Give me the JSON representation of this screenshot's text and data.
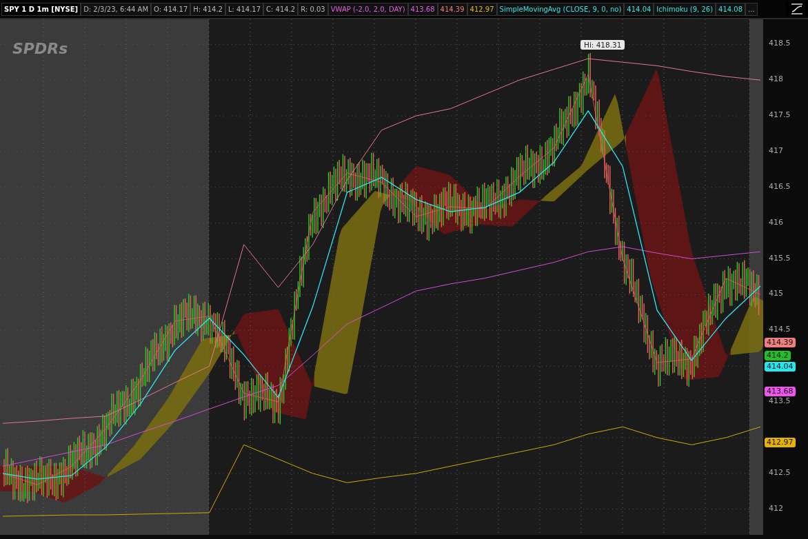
{
  "header": {
    "symbol": "SPY 1 D 1m [NYSE]",
    "items": [
      {
        "text": "D: 2/3/23, 6:44 AM",
        "color": "#b8b8b8"
      },
      {
        "text": "O: 414.17",
        "color": "#b8b8b8"
      },
      {
        "text": "H: 414.2",
        "color": "#b8b8b8"
      },
      {
        "text": "L: 414.17",
        "color": "#b8b8b8"
      },
      {
        "text": "C: 414.2",
        "color": "#b8b8b8"
      },
      {
        "text": "R: 0.03",
        "color": "#b8b8b8"
      },
      {
        "text": "VWAP (-2.0, 2.0, DAY)",
        "color": "#e65ce6"
      },
      {
        "text": "413.68",
        "color": "#e65ce6"
      },
      {
        "text": "414.39",
        "color": "#f07878"
      },
      {
        "text": "412.97",
        "color": "#e6b800"
      },
      {
        "text": "SimpleMovingAvg (CLOSE, 9, 0, no)",
        "color": "#2ee6e6"
      },
      {
        "text": "414.04",
        "color": "#2ee6e6"
      },
      {
        "text": "Ichimoku (9, 26)",
        "color": "#2ee6e6"
      },
      {
        "text": "414.08",
        "color": "#2ee6e6"
      },
      {
        "text": "..."
      }
    ]
  },
  "chart": {
    "logo": "SPDRs",
    "high_label": "Hi: 418.31",
    "price_badges": [
      {
        "text": "414.39",
        "color": "#f08080"
      },
      {
        "text": "414.2",
        "color": "#22c022"
      },
      {
        "text": "414.04",
        "color": "#22e8f0"
      },
      {
        "text": "413.68",
        "color": "#ee55ee"
      },
      {
        "text": "412.97",
        "color": "#e6b400"
      }
    ],
    "chart_data": {
      "type": "line",
      "grid": true,
      "ylim": [
        411.64,
        418.85
      ],
      "yticks": [
        418.5,
        418,
        417.5,
        417,
        416.5,
        416,
        415.5,
        415,
        414.5,
        413.5,
        412.5,
        412
      ],
      "series": [
        {
          "color": "#e8605c",
          "values": [
            412.5,
            412.34,
            412.6,
            413.13,
            413.8,
            414.63,
            414.7,
            413.62,
            413.5,
            416.15,
            416.7,
            416.57,
            416.09,
            416.23,
            416.2,
            416.65,
            417.05,
            418.08,
            415.5,
            414.05,
            414.1,
            415.23,
            415.0
          ]
        },
        {
          "color": "#2ee6f0",
          "values": [
            412.5,
            412.42,
            412.47,
            412.87,
            413.47,
            414.22,
            414.67,
            414.16,
            413.56,
            414.83,
            416.43,
            416.64,
            416.33,
            416.16,
            416.22,
            416.43,
            416.85,
            417.57,
            416.79,
            414.78,
            414.08,
            414.67,
            415.12
          ]
        },
        {
          "color": "#d24fd2",
          "values": [
            412.6,
            412.7,
            412.8,
            412.9,
            413.07,
            413.23,
            413.4,
            413.57,
            413.73,
            414.15,
            414.59,
            414.82,
            415.05,
            415.15,
            415.23,
            415.34,
            415.45,
            415.6,
            415.67,
            415.58,
            415.5,
            415.55,
            415.6
          ]
        },
        {
          "color": "#e07a8a",
          "values": [
            413.2,
            413.23,
            413.27,
            413.3,
            413.53,
            413.77,
            414.0,
            415.7,
            415.1,
            415.7,
            416.6,
            417.3,
            417.5,
            417.6,
            417.8,
            418.0,
            418.15,
            418.3,
            418.25,
            418.2,
            418.12,
            418.05,
            418.0
          ]
        },
        {
          "color": "#d4a800",
          "values": [
            411.9,
            411.91,
            411.92,
            411.92,
            411.93,
            411.94,
            411.95,
            412.9,
            412.7,
            412.5,
            412.37,
            412.44,
            412.5,
            412.6,
            412.7,
            412.8,
            412.9,
            413.05,
            413.15,
            413.0,
            412.9,
            413.0,
            413.15
          ]
        }
      ]
    }
  }
}
